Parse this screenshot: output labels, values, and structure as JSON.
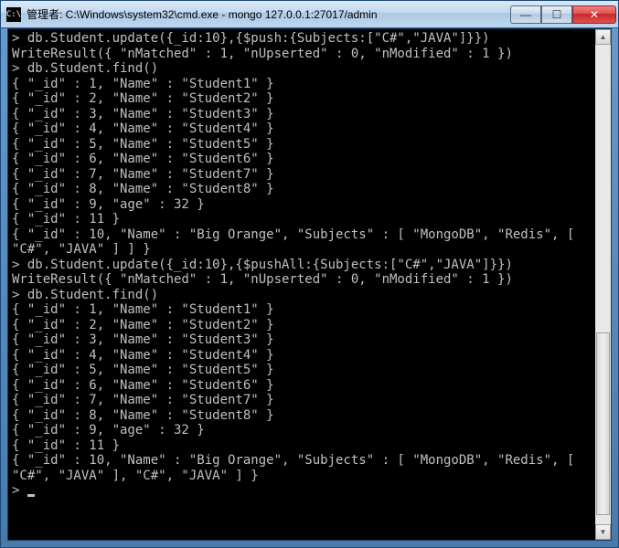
{
  "title": "管理者: C:\\Windows\\system32\\cmd.exe - mongo  127.0.0.1:27017/admin",
  "icon_label": "C:\\",
  "controls": {
    "min": "—",
    "max": "☐",
    "close": "✕"
  },
  "scrollbar": {
    "up": "▲",
    "down": "▼"
  },
  "terminal_lines": [
    "> db.Student.update({_id:10},{$push:{Subjects:[\"C#\",\"JAVA\"]}})",
    "WriteResult({ \"nMatched\" : 1, \"nUpserted\" : 0, \"nModified\" : 1 })",
    "> db.Student.find()",
    "{ \"_id\" : 1, \"Name\" : \"Student1\" }",
    "{ \"_id\" : 2, \"Name\" : \"Student2\" }",
    "{ \"_id\" : 3, \"Name\" : \"Student3\" }",
    "{ \"_id\" : 4, \"Name\" : \"Student4\" }",
    "{ \"_id\" : 5, \"Name\" : \"Student5\" }",
    "{ \"_id\" : 6, \"Name\" : \"Student6\" }",
    "{ \"_id\" : 7, \"Name\" : \"Student7\" }",
    "{ \"_id\" : 8, \"Name\" : \"Student8\" }",
    "{ \"_id\" : 9, \"age\" : 32 }",
    "{ \"_id\" : 11 }",
    "{ \"_id\" : 10, \"Name\" : \"Big Orange\", \"Subjects\" : [ \"MongoDB\", \"Redis\", [ \"C#\", \"JAVA\" ] ] }",
    "> db.Student.update({_id:10},{$pushAll:{Subjects:[\"C#\",\"JAVA\"]}})",
    "WriteResult({ \"nMatched\" : 1, \"nUpserted\" : 0, \"nModified\" : 1 })",
    "> db.Student.find()",
    "{ \"_id\" : 1, \"Name\" : \"Student1\" }",
    "{ \"_id\" : 2, \"Name\" : \"Student2\" }",
    "{ \"_id\" : 3, \"Name\" : \"Student3\" }",
    "{ \"_id\" : 4, \"Name\" : \"Student4\" }",
    "{ \"_id\" : 5, \"Name\" : \"Student5\" }",
    "{ \"_id\" : 6, \"Name\" : \"Student6\" }",
    "{ \"_id\" : 7, \"Name\" : \"Student7\" }",
    "{ \"_id\" : 8, \"Name\" : \"Student8\" }",
    "{ \"_id\" : 9, \"age\" : 32 }",
    "{ \"_id\" : 11 }",
    "{ \"_id\" : 10, \"Name\" : \"Big Orange\", \"Subjects\" : [ \"MongoDB\", \"Redis\", [ \"C#\", \"JAVA\" ], \"C#\", \"JAVA\" ] }",
    "> "
  ]
}
